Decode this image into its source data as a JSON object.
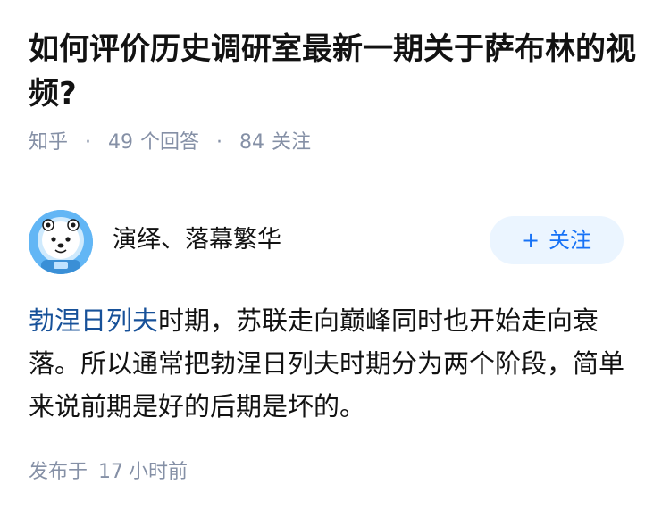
{
  "question": {
    "title": "如何评价历史调研室最新一期关于萨布林的视频?",
    "source": "知乎",
    "answer_count": "49",
    "answer_unit": "个回答",
    "follower_count": "84",
    "follower_unit": "关注",
    "separator": "·"
  },
  "answer": {
    "author": {
      "name": "演绎、落幕繁华",
      "avatar_icon": "astronaut-bear-avatar-icon",
      "follow_label": "关注",
      "follow_prefix": "+"
    },
    "link_text": "勃涅日列夫",
    "body_text": "时期，苏联走向巅峰同时也开始走向衰落。所以通常把勃涅日列夫时期分为两个阶段，简单来说前期是好的后期是坏的。",
    "publish_prefix": "发布于",
    "publish_value": "17",
    "publish_unit": "小时前"
  },
  "colors": {
    "link": "#175199",
    "meta": "#8590a6",
    "follow_text": "#1772f6",
    "follow_bg": "#ebf5ff",
    "avatar_bg": "#62b6f5"
  }
}
